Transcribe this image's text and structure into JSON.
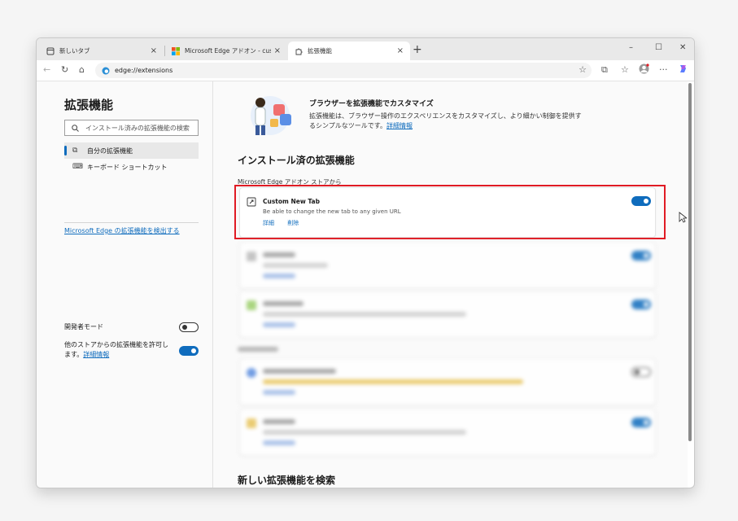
{
  "tabs": [
    {
      "title": "新しいタブ",
      "close": "×"
    },
    {
      "title": "Microsoft Edge アドオン - custom ne",
      "close": "×"
    },
    {
      "title": "拡張機能",
      "close": "×"
    }
  ],
  "new_tab": "+",
  "window_controls": {
    "minimize": "–",
    "maximize": "☐",
    "close": "✕"
  },
  "toolbar": {
    "address": "edge://extensions"
  },
  "sidebar": {
    "title": "拡張機能",
    "search_placeholder": "インストール済みの拡張機能の検索",
    "nav": [
      {
        "label": "自分の拡張機能",
        "icon": "puzzle-icon"
      },
      {
        "label": "キーボード ショートカット",
        "icon": "keyboard-icon"
      }
    ],
    "discover_link": "Microsoft Edge の拡張機能を検出する",
    "dev_mode_label": "開発者モード",
    "allow_other_stores_label": "他のストアからの拡張機能を許可します。",
    "allow_other_stores_link": "詳細情報"
  },
  "main": {
    "hero_title": "ブラウザーを拡張機能でカスタマイズ",
    "hero_desc": "拡張機能は、ブラウザー操作のエクスペリエンスをカスタマイズし、より細かい制御を提供するシンプルなツールです。",
    "hero_link": "詳細情報",
    "installed_title": "インストール済の拡張機能",
    "store_subtitle": "Microsoft Edge アドオン ストアから",
    "extension": {
      "name": "Custom New Tab",
      "description": "Be able to change the new tab to any given URL",
      "details": "詳細",
      "remove": "削除",
      "enabled": true
    },
    "find_new_title": "新しい拡張機能を検索"
  },
  "colors": {
    "accent": "#0f6cbd",
    "highlight": "#e01b24"
  }
}
